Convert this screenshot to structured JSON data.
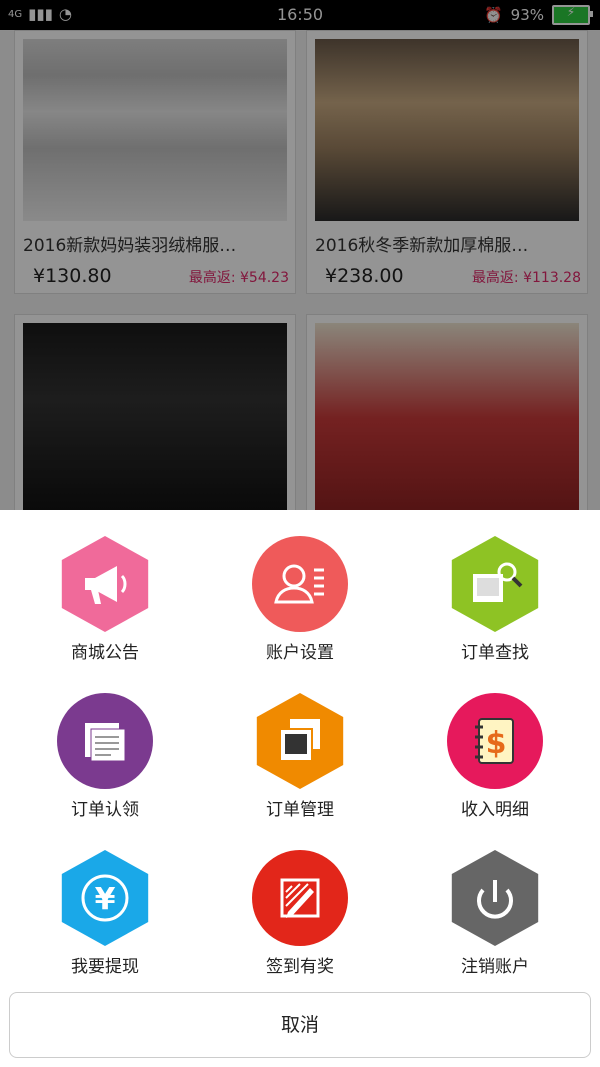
{
  "status_bar": {
    "signal": "4G",
    "time": "16:50",
    "battery_percent": "93%"
  },
  "products": [
    {
      "name": "2016新款妈妈装羽绒棉服…",
      "price": "¥130.80",
      "rebate": "最高返: ¥54.23"
    },
    {
      "name": "2016秋冬季新款加厚棉服…",
      "price": "¥238.00",
      "rebate": "最高返: ¥113.28"
    },
    {
      "name": "",
      "price": "",
      "rebate": ""
    },
    {
      "name": "",
      "price": "",
      "rebate": ""
    }
  ],
  "menu": [
    {
      "label": "商城公告",
      "color": "#f06a9a",
      "shape": "hex",
      "icon": "megaphone-icon"
    },
    {
      "label": "账户设置",
      "color": "#ef5a5a",
      "shape": "circle",
      "icon": "user-settings-icon"
    },
    {
      "label": "订单查找",
      "color": "#8ec324",
      "shape": "hex",
      "icon": "order-search-icon"
    },
    {
      "label": "订单认领",
      "color": "#7b3a8f",
      "shape": "circle",
      "icon": "document-icon"
    },
    {
      "label": "订单管理",
      "color": "#f08a00",
      "shape": "hex",
      "icon": "photos-icon"
    },
    {
      "label": "收入明细",
      "color": "#e6195c",
      "shape": "circle",
      "icon": "ledger-dollar-icon"
    },
    {
      "label": "我要提现",
      "color": "#1aa8e8",
      "shape": "hex",
      "icon": "yen-icon"
    },
    {
      "label": "签到有奖",
      "color": "#e2261a",
      "shape": "circle",
      "icon": "pencil-sign-icon"
    },
    {
      "label": "注销账户",
      "color": "#666666",
      "shape": "hex",
      "icon": "power-icon"
    }
  ],
  "cancel_label": "取消"
}
